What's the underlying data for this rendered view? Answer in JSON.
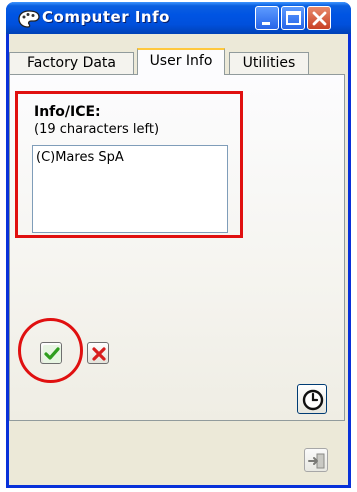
{
  "window": {
    "title": "Computer Info",
    "app_icon": "palette-icon",
    "controls": {
      "minimize": "minimize-icon",
      "maximize": "maximize-icon",
      "close": "close-icon"
    }
  },
  "tabs": [
    {
      "label": "Factory Data",
      "active": false
    },
    {
      "label": "User Info",
      "active": true
    },
    {
      "label": "Utilities",
      "active": false
    }
  ],
  "user_info": {
    "field_label": "Info/ICE:",
    "chars_left": "(19 characters left)",
    "value": "(C)Mares SpA"
  },
  "buttons": {
    "confirm": "checkmark-icon",
    "cancel": "x-icon",
    "clock": "clock-icon",
    "exit": "exit-icon"
  },
  "colors": {
    "titlebar": "#0054e3",
    "highlight": "#e01010",
    "confirm_green": "#2e9e1e",
    "cancel_red": "#d81e1e",
    "window_bg": "#ece9d8"
  }
}
